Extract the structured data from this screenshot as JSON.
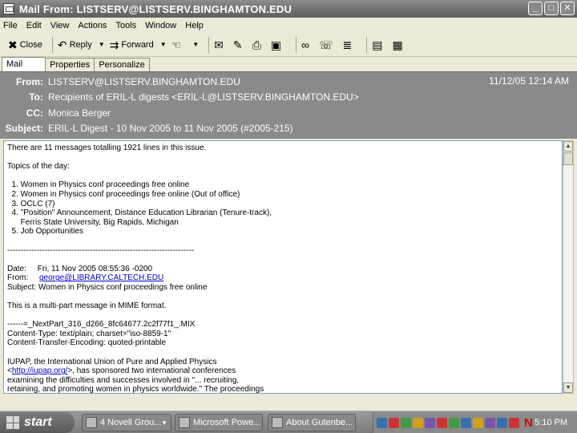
{
  "window": {
    "title": "Mail From: LISTSERV@LISTSERV.BINGHAMTON.EDU",
    "buttons": {
      "minimize": "_",
      "maximize": "□",
      "close": "✕"
    }
  },
  "menu": [
    "File",
    "Edit",
    "View",
    "Actions",
    "Tools",
    "Window",
    "Help"
  ],
  "toolbar": {
    "close_label": "Close",
    "reply_label": "Reply",
    "forward_label": "Forward"
  },
  "tabs": [
    "Mail",
    "Properties",
    "Personalize"
  ],
  "header": {
    "from_label": "From:",
    "from_value": "LISTSERV@LISTSERV.BINGHAMTON.EDU",
    "date": "11/12/05 12:14 AM",
    "to_label": "To:",
    "to_value": "Recipients of ERIL-L digests <ERIL-L@LISTSERV.BINGHAMTON.EDU>",
    "cc_label": "CC:",
    "cc_value": "Monica Berger",
    "subject_label": "Subject:",
    "subject_value": "ERIL-L Digest - 10 Nov 2005 to 11 Nov 2005 (#2005-215)"
  },
  "message": {
    "intro": "There are 11 messages totalling 1921 lines in this issue.",
    "topics_heading": "Topics of the day:",
    "topics": [
      "  1. Women in Physics conf proceedings free online",
      "  2. Women in Physics conf proceedings free online (Out of office)",
      "  3. OCLC (7)",
      "  4. \"Position\" Announcement, Distance Education Librarian (Tenure-track),",
      "      Ferris State University, Big Rapids, Michigan",
      "  5. Job Opportunities"
    ],
    "separator": "----------------------------------------------------------------------",
    "date_line": "Date:     Fri, 11 Nov 2005 08:55:36 -0200",
    "from_prefix": "From:     ",
    "from_email": "george@LIBRARY.CALTECH.EDU",
    "subject_line": "Subject: Women in Physics conf proceedings free online",
    "mime_line": "This is a multi-part message in MIME format.",
    "part_line": "------=_NextPart_316_d266_8fc64677.2c2f77f1_.MIX",
    "content_type": "Content-Type: text/plain; charset=\"iso-8859-1\"",
    "encoding": "Content-Transfer-Encoding: quoted-printable",
    "iupap_line1": "IUPAP, the International Union of Pure and Applied Physics",
    "iupap_prefix": "<",
    "iupap_link": "http://iupap.org/",
    "iupap_suffix": ">, has sponsored two international conferences",
    "iupap_line3": "examining the difficulties and successes involved in \"... recruiting,",
    "iupap_line4": "retaining, and promoting women in physics worldwide.\" The proceedings"
  },
  "taskbar": {
    "start_label": "start",
    "tasks": [
      "4 Novell Grou...",
      "Microsoft Powe...",
      "About Gutenbe..."
    ],
    "clock": "5:10 PM",
    "tray_colors": [
      "#3a6fb0",
      "#cc3333",
      "#449944",
      "#d0a020",
      "#7755aa",
      "#cc3333",
      "#449944",
      "#3a6fb0",
      "#d0a020",
      "#7755aa",
      "#3a6fb0",
      "#cc3333"
    ],
    "tray_letter": "N"
  }
}
